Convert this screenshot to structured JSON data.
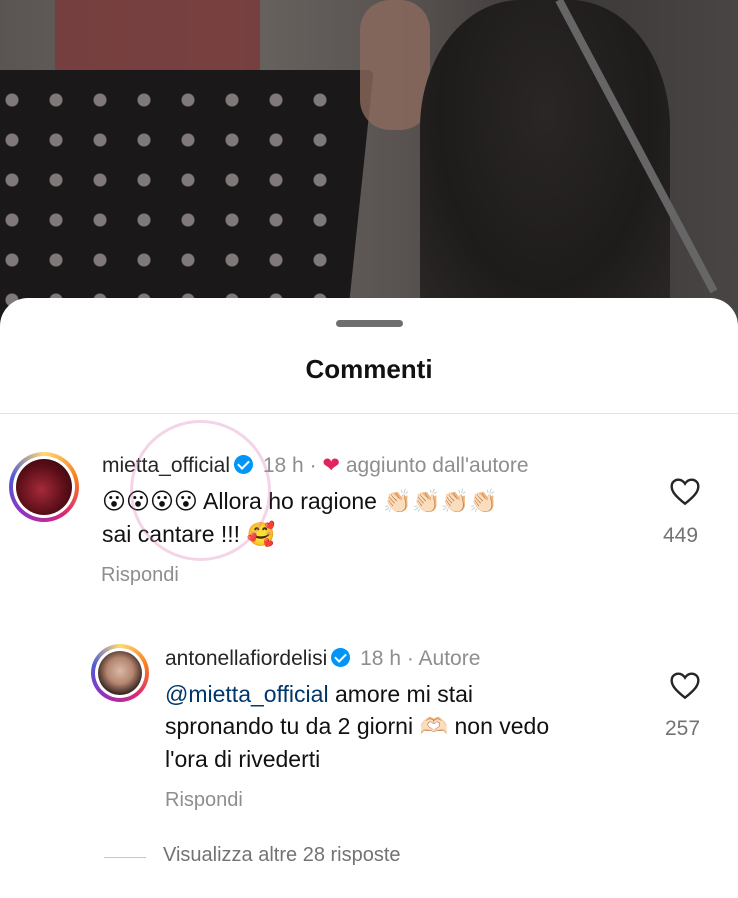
{
  "sheet": {
    "title": "Commenti"
  },
  "comments": [
    {
      "username": "mietta_official",
      "time": "18 h",
      "badge": "❤",
      "badge_label": "aggiunto dall'autore",
      "emojis": "😮😮😮😮",
      "text_line1": "Allora ho ragione",
      "claps": "👏🏻👏🏻👏🏻👏🏻",
      "text_line2": "sai cantare !!!",
      "emoji_end": "🥰",
      "likes": "449",
      "reply": "Rispondi"
    },
    {
      "username": "antonellafiordelisi",
      "time": "18 h",
      "badge_label": "Autore",
      "mention": "@mietta_official",
      "text_line1": "amore mi stai",
      "text_line2a": "spronando tu da 2 giorni",
      "hearthands": "🫶🏻",
      "text_line2b": "non vedo",
      "text_line3": "l'ora di rivederti",
      "likes": "257",
      "reply": "Rispondi"
    }
  ],
  "more_replies": "Visualizza altre 28 risposte",
  "colors": {
    "link": "#00376b",
    "verified": "#0095f6",
    "muted": "#8e8e8e"
  }
}
